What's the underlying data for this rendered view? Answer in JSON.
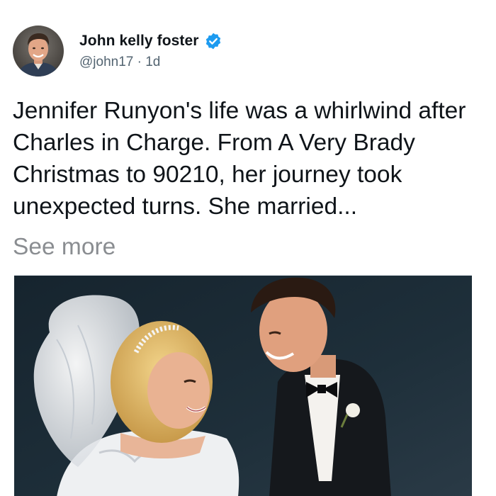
{
  "author": {
    "display_name": "John kelly foster",
    "handle": "@john17",
    "separator": " · ",
    "age": "1d",
    "verified": true,
    "verified_color": "#1d9bf0",
    "avatar_icon": "profile-photo"
  },
  "post": {
    "text": "Jennifer Runyon's life was a whirlwind after Charles in Charge. From A Very Brady Christmas to 90210, her journey took unexpected turns. She married...",
    "see_more_label": "See more",
    "see_more_color": "#8a8d91"
  },
  "media": {
    "type": "photo",
    "icon": "wedding-photo"
  }
}
